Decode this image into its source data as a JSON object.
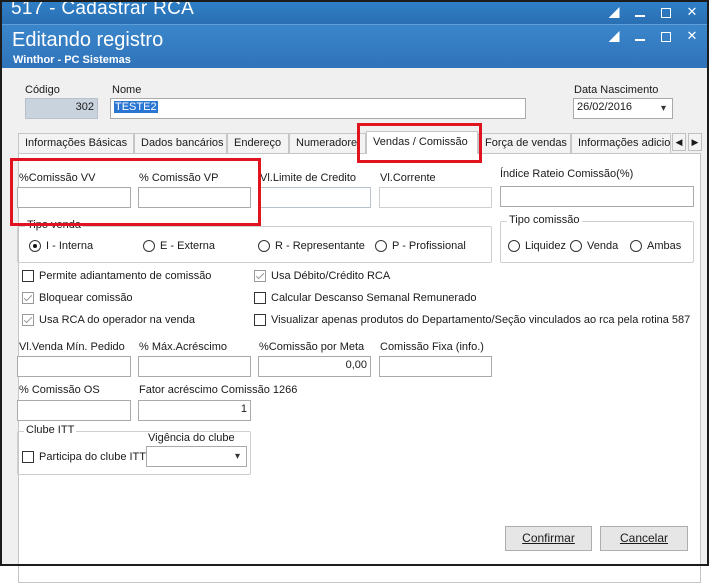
{
  "window": {
    "outer_title": "517 - Cadastrar RCA",
    "title": "Editando registro",
    "subtitle": "Winthor - PC Sistemas"
  },
  "header": {
    "codigo_label": "Código",
    "codigo_value": "302",
    "nome_label": "Nome",
    "nome_value": "TESTE2",
    "data_nasc_label": "Data Nascimento",
    "data_nasc_value": "26/02/2016"
  },
  "tabs": [
    {
      "label": "Informações Básicas"
    },
    {
      "label": "Dados bancários"
    },
    {
      "label": "Endereço"
    },
    {
      "label": "Numeradore"
    },
    {
      "label": "Vendas  / Comissão"
    },
    {
      "label": "Força de vendas"
    },
    {
      "label": "Informações adicionais"
    }
  ],
  "vendas": {
    "comissao_vv_label": "%Comissão VV",
    "comissao_vp_label": "% Comissão VP",
    "vl_limite_label": "Vl.Limite de Credito",
    "vl_corrente_label": "Vl.Corrente",
    "indice_rateio_label": "Índice Rateio Comissão(%)",
    "tipo_venda_title": "Tipo venda",
    "tipo_venda_options": [
      "I - Interna",
      "E - Externa",
      "R - Representante",
      "P - Profissional"
    ],
    "tipo_comissao_title": "Tipo comissão",
    "tipo_comissao_options": [
      "Liquidez",
      "Venda",
      "Ambas"
    ],
    "checks": [
      {
        "label": "Permite adiantamento de comissão",
        "checked": false
      },
      {
        "label": "Usa Débito/Crédito RCA",
        "checked": true
      },
      {
        "label": "Bloquear comissão",
        "checked": true
      },
      {
        "label": "Calcular Descanso Semanal Remunerado",
        "checked": false
      },
      {
        "label": "Usa RCA do operador na venda",
        "checked": true
      },
      {
        "label": "Visualizar apenas produtos do Departamento/Seção vinculados ao rca pela rotina 587",
        "checked": false
      }
    ],
    "vl_venda_min_label": "Vl.Venda Mín. Pedido",
    "max_acrescimo_label": "% Máx.Acréscimo",
    "comissao_meta_label": "%Comissão por Meta",
    "comissao_meta_value": "0,00",
    "comissao_fixa_label": "Comissão Fixa (info.)",
    "comissao_os_label": "% Comissão OS",
    "fator_label": "Fator acréscimo Comissão 1266",
    "fator_value": "1",
    "clube_title": "Clube ITT",
    "vigencia_label": "Vigência do clube",
    "participa_label": "Participa do clube ITT"
  },
  "footer": {
    "confirmar": "Confirmar",
    "cancelar": "Cancelar"
  },
  "colors": {
    "title_bar": "#2f7fc6",
    "highlight": "#e0141e",
    "selection": "#2a76d2"
  }
}
